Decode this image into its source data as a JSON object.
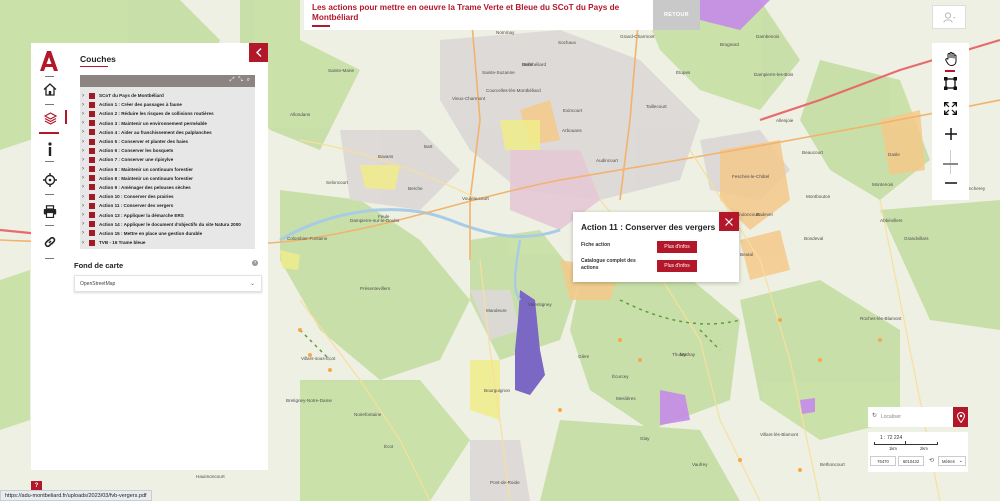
{
  "header": {
    "title": "Les actions pour mettre en oeuvre la Trame Verte et Bleue du SCoT du Pays de Montbéliard",
    "retour_label": "RETOUR"
  },
  "left_toolbar": {
    "items": [
      {
        "name": "home-icon"
      },
      {
        "name": "layers-icon",
        "active": true
      },
      {
        "name": "info-icon"
      },
      {
        "name": "locate-icon"
      },
      {
        "name": "print-icon"
      },
      {
        "name": "link-icon"
      }
    ]
  },
  "layer_panel": {
    "heading": "Couches",
    "layers": [
      "SCoT du Pays de Montbéliard",
      "Action 1 : Créer des passages à faune",
      "Action 2 : Réduire les risques de collisions routières",
      "Action 3 : Maintenir un environnement perméable",
      "Action 4 : Aider au franchissement des palplanches",
      "Action 5 : Conserver et planter des haies",
      "Action 6 : Conserver les bosquets",
      "Action 7 : Conserver une ripisylve",
      "Action 8 : Maintenir un continuum forestier",
      "Action 8 : Maintenir un continuum forestier",
      "Action 9 : Aménager des pelouses sèches",
      "Action 10 : Conserver des prairies",
      "Action 11 : Conserver des vergers",
      "Action 13 : Appliquer la démarche ERS",
      "Action 14 : Appliquer le document d'objectifs du site Natura 2000",
      "Action 15 : Mettre en place une gestion durable",
      "TVB - 16 Trame bleue"
    ],
    "basemap_heading": "Fond de carte",
    "basemap_selected": "OpenStreetMap"
  },
  "popup": {
    "title": "Action 11 : Conserver des vergers",
    "rows": [
      {
        "label": "Fiche action",
        "button": "Plus d'infos"
      },
      {
        "label": "Catalogue complet des actions",
        "button": "Plus d'infos"
      }
    ]
  },
  "locate": {
    "placeholder": "Localiser"
  },
  "scale": {
    "ratio": "1 : 72 224",
    "tick_1": "1km",
    "tick_2": "2km",
    "coord_x": "76470",
    "coord_y": "6010432",
    "unit": "Mètres"
  },
  "status": {
    "url": "https://adu-montbeliard.fr/uploads/2023/03/fvb-vergers.pdf",
    "help_label": "?"
  },
  "map_labels": [
    {
      "text": "Montbéliard"
    },
    {
      "text": "Audincourt"
    },
    {
      "text": "Vieux-Charmont"
    },
    {
      "text": "Sochaux"
    },
    {
      "text": "Exincourt"
    },
    {
      "text": "Étupes"
    },
    {
      "text": "Taillecourt"
    },
    {
      "text": "Seloncourt"
    },
    {
      "text": "Hérimoncourt"
    },
    {
      "text": "Valentigney"
    },
    {
      "text": "Mandeure"
    },
    {
      "text": "Mathay"
    },
    {
      "text": "Bourguignon"
    },
    {
      "text": "Pont-de-Roide"
    },
    {
      "text": "Bavans"
    },
    {
      "text": "Arbouans"
    },
    {
      "text": "Bart"
    },
    {
      "text": "Voujeaucourt"
    },
    {
      "text": "Colombier-Fontaine"
    },
    {
      "text": "Dampierre-les-Bois"
    },
    {
      "text": "Beaucourt"
    },
    {
      "text": "Fesches-le-Châtel"
    },
    {
      "text": "Allenjoie"
    },
    {
      "text": "Badevel"
    },
    {
      "text": "Blamont"
    },
    {
      "text": "Glay"
    },
    {
      "text": "Écurcey"
    },
    {
      "text": "Villars-sous-Écot"
    },
    {
      "text": "Dambenois"
    },
    {
      "text": "Brognard"
    },
    {
      "text": "Courcelles-lès-Montbéliard"
    },
    {
      "text": "Berche"
    },
    {
      "text": "Dampierre-sur-le-Doubs"
    },
    {
      "text": "Beutal"
    },
    {
      "text": "Montenois"
    },
    {
      "text": "Sainte-Marie"
    },
    {
      "text": "Thulay"
    },
    {
      "text": "Vandoncourt"
    },
    {
      "text": "Montbouton"
    },
    {
      "text": "Dasle"
    },
    {
      "text": "Abbévillers"
    },
    {
      "text": "Meslières"
    },
    {
      "text": "Roches-lès-Blamont"
    },
    {
      "text": "Villars-lès-Blamont"
    },
    {
      "text": "Bondeval"
    },
    {
      "text": "Noirefontaine"
    },
    {
      "text": "Vaufrey"
    },
    {
      "text": "Glère"
    },
    {
      "text": "Écot"
    },
    {
      "text": "Hauimoncourt"
    },
    {
      "text": "Bretigney-Notre-Dame"
    },
    {
      "text": "Feule"
    },
    {
      "text": "Présentevillers"
    },
    {
      "text": "Allondans"
    },
    {
      "text": "Sainte-Suzanne"
    },
    {
      "text": "Grand-Charmont"
    },
    {
      "text": "Nommay"
    },
    {
      "text": "Vieux-Charmont"
    },
    {
      "text": "Bethoncourt"
    },
    {
      "text": "Grandvillars"
    },
    {
      "text": "Joncherey"
    },
    {
      "text": "Delle"
    }
  ]
}
